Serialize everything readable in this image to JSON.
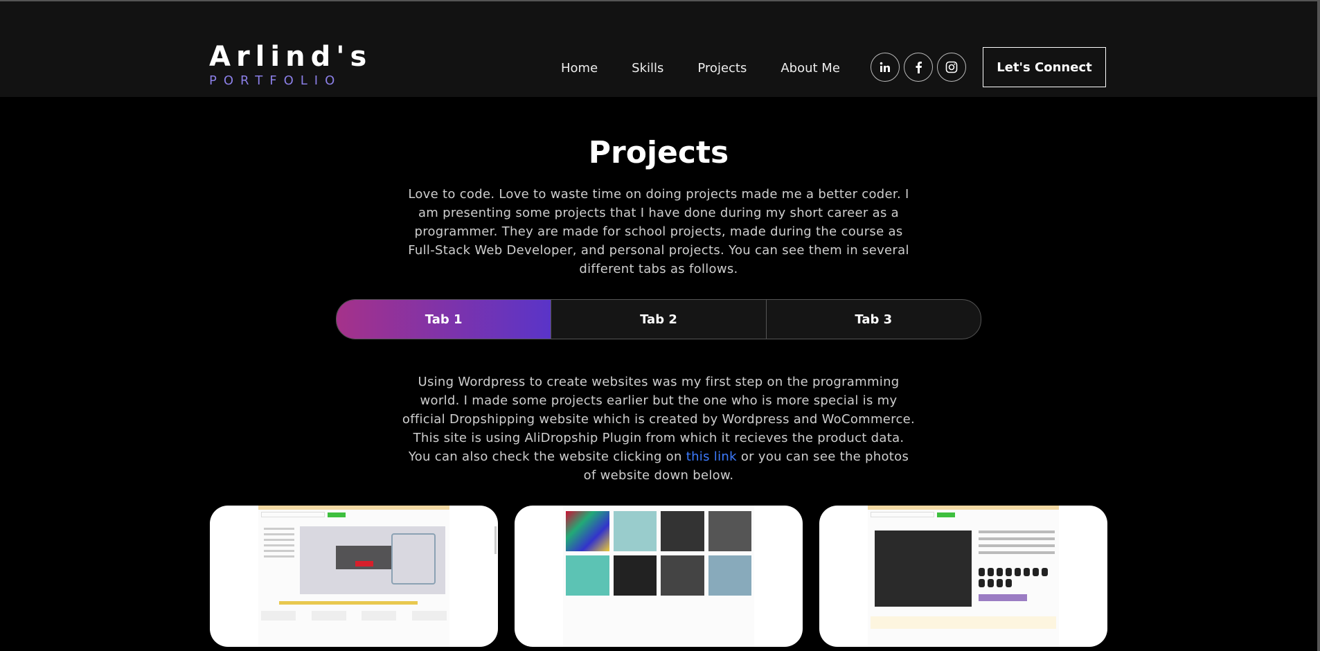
{
  "brand": {
    "title": "Arlind's",
    "subtitle": "PORTFOLIO"
  },
  "nav": [
    {
      "label": "Home"
    },
    {
      "label": "Skills"
    },
    {
      "label": "Projects"
    },
    {
      "label": "About Me"
    }
  ],
  "socials": [
    "linkedin-icon",
    "facebook-icon",
    "instagram-icon"
  ],
  "cta_label": "Let's Connect",
  "projects": {
    "title": "Projects",
    "intro": "Love to code. Love to waste time on doing projects made me a better coder. I am presenting some projects that I have done during my short career as a programmer. They are made for school projects, made during the course as Full-Stack Web Developer, and personal projects. You can see them in several different tabs as follows.",
    "tabs": [
      "Tab 1",
      "Tab 2",
      "Tab 3"
    ],
    "active_tab": "Tab 1",
    "desc_before": "Using Wordpress to create websites was my first step on the programming world. I made some projects earlier but the one who is more special is my official Dropshipping website which is created by Wordpress and WoCommerce. This site is using AliDropship Plugin from which it recieves the product data. You can also check the website clicking on ",
    "desc_link": "this link",
    "desc_after": " or you can see the photos of website down below."
  },
  "colors": {
    "accent": "#8b7fe6",
    "tab_gradient_start": "#a5328a",
    "tab_gradient_end": "#5a34c8",
    "link": "#3d7bff"
  }
}
